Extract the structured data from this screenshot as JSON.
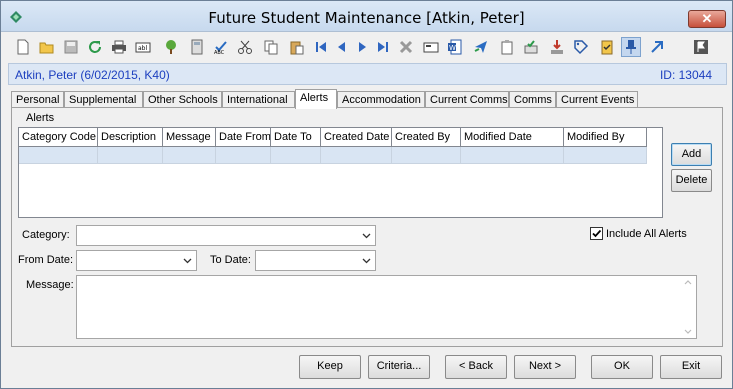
{
  "window": {
    "title": "Future Student Maintenance  [Atkin, Peter]",
    "close_label": "✕"
  },
  "toolbar": {
    "icons": [
      "new-icon",
      "open-icon",
      "save-icon",
      "refresh-icon",
      "print-icon",
      "text-field-icon",
      "tree-icon",
      "calculator-icon",
      "spellcheck-icon",
      "cut-icon",
      "copy-icon",
      "paste-icon",
      "first-record-icon",
      "previous-record-icon",
      "next-record-icon",
      "last-record-icon",
      "delete-icon",
      "card-icon",
      "word-icon",
      "send-icon",
      "clipboard-icon",
      "approve-icon",
      "download-icon",
      "tag-icon",
      "checklist-icon",
      "pin-icon",
      "arrow-up-right-icon",
      "flag-icon"
    ]
  },
  "student": {
    "name_line": "Atkin, Peter (6/02/2015, K40)",
    "id_line": "ID: 13044"
  },
  "tabs": [
    "Personal",
    "Supplemental",
    "Other Schools",
    "International",
    "Alerts",
    "Accommodation",
    "Current Comms",
    "Comms",
    "Current Events"
  ],
  "active_tab": "Alerts",
  "alerts": {
    "section_label": "Alerts",
    "columns": [
      "Category Code",
      "Description",
      "Message",
      "Date From",
      "Date To",
      "Created Date",
      "Created By",
      "Modified Date",
      "Modified By"
    ],
    "add_label": "Add",
    "delete_label": "Delete"
  },
  "form": {
    "category_label": "Category:",
    "category_value": "",
    "include_all_label": "Include All Alerts",
    "include_all_checked": true,
    "from_date_label": "From Date:",
    "from_date_value": "",
    "to_date_label": "To Date:",
    "to_date_value": "",
    "message_label": "Message:",
    "message_value": ""
  },
  "footer": {
    "keep": "Keep",
    "criteria": "Criteria...",
    "back": "< Back",
    "next": "Next >",
    "ok": "OK",
    "exit": "Exit"
  },
  "colors": {
    "accent_text": "#1c3fbf",
    "selected_row": "#d9e5f3",
    "titlebar": "#c7d9ee"
  }
}
